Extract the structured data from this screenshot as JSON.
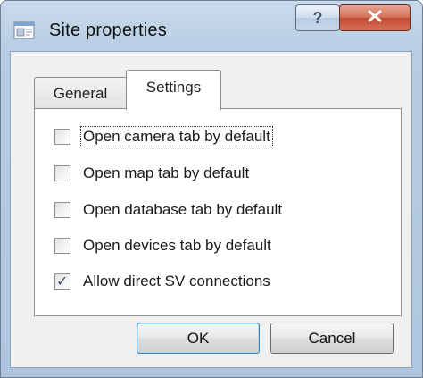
{
  "window": {
    "title": "Site properties",
    "help_glyph": "?",
    "colors": {
      "title_gradient_top": "#c9daea",
      "close_button": "#c24a32",
      "client_background": "#f0f0f0"
    }
  },
  "tabs": [
    {
      "label": "General",
      "active": false
    },
    {
      "label": "Settings",
      "active": true
    }
  ],
  "options": [
    {
      "label": "Open camera tab by default",
      "checked": false,
      "focused": true
    },
    {
      "label": "Open map tab by default",
      "checked": false,
      "focused": false
    },
    {
      "label": "Open database tab by default",
      "checked": false,
      "focused": false
    },
    {
      "label": "Open devices tab by default",
      "checked": false,
      "focused": false
    },
    {
      "label": "Allow direct SV connections",
      "checked": true,
      "focused": false
    }
  ],
  "buttons": {
    "ok_label": "OK",
    "cancel_label": "Cancel"
  },
  "icons": {
    "app": "site-properties-icon",
    "help": "help-icon",
    "close": "close-icon",
    "check": "checkmark-icon"
  }
}
